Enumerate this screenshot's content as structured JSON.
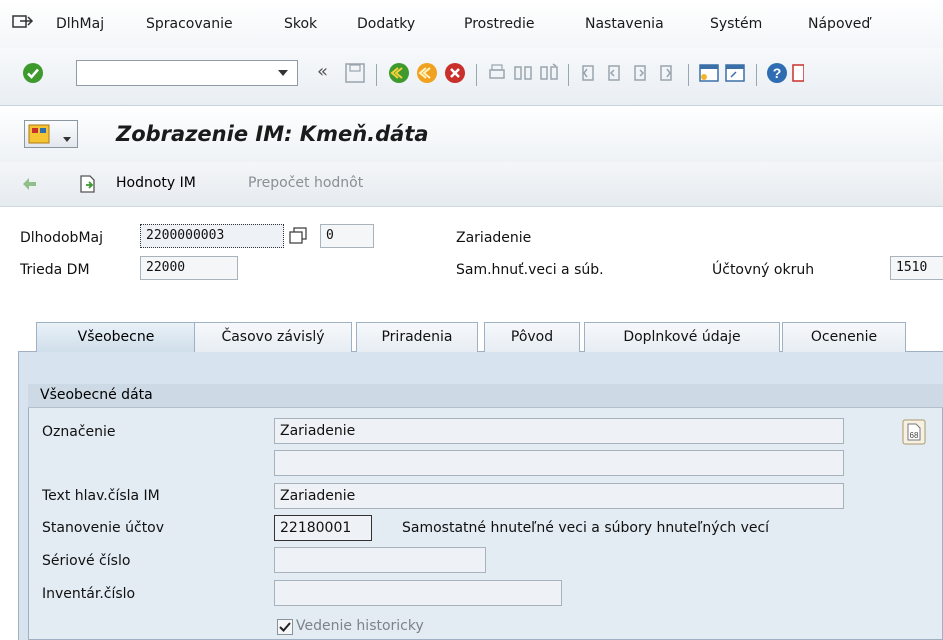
{
  "menu": {
    "items": [
      {
        "label": "DlhMaj"
      },
      {
        "label": "Spracovanie"
      },
      {
        "label": "Skok"
      },
      {
        "label": "Dodatky"
      },
      {
        "label": "Prostredie"
      },
      {
        "label": "Nastavenia"
      },
      {
        "label": "Systém"
      },
      {
        "label": "Nápoveď"
      }
    ]
  },
  "toolbar": {
    "command_field_value": "",
    "back_chevron": "«"
  },
  "title": {
    "text": "Zobrazenie IM:  Kmeň.dáta"
  },
  "app_toolbar": {
    "values_button": "Hodnoty IM",
    "recalc_button": "Prepočet hodnôt"
  },
  "header": {
    "asset_label": "DlhodobMaj",
    "asset_value": "2200000003",
    "subnumber_value": "0",
    "asset_description": "Zariadenie",
    "class_label": "Trieda DM",
    "class_value": "22000",
    "class_description": "Sam.hnuť.veci a súb.",
    "company_label": "Účtovný okruh",
    "company_value": "1510"
  },
  "tabs": [
    {
      "label": "Všeobecne",
      "active": true
    },
    {
      "label": "Časovo závislý",
      "active": false
    },
    {
      "label": "Priradenia",
      "active": false
    },
    {
      "label": "Pôvod",
      "active": false
    },
    {
      "label": "Doplnkové údaje",
      "active": false
    },
    {
      "label": "Ocenenie",
      "active": false
    }
  ],
  "general_data": {
    "group_title": "Všeobecné dáta",
    "designation_label": "Označenie",
    "designation_value": "Zariadenie",
    "designation2_value": "",
    "main_text_label": "Text hlav.čísla IM",
    "main_text_value": "Zariadenie",
    "account_label": "Stanovenie účtov",
    "account_value": "22180001",
    "account_description": "Samostatné hnuteľné veci a súbory hnuteľných vecí",
    "serial_label": "Sériové číslo",
    "serial_value": "",
    "inventory_label": "Inventár.číslo",
    "inventory_value": "",
    "history_checkbox_label": "Vedenie historicky",
    "history_checked": true
  }
}
